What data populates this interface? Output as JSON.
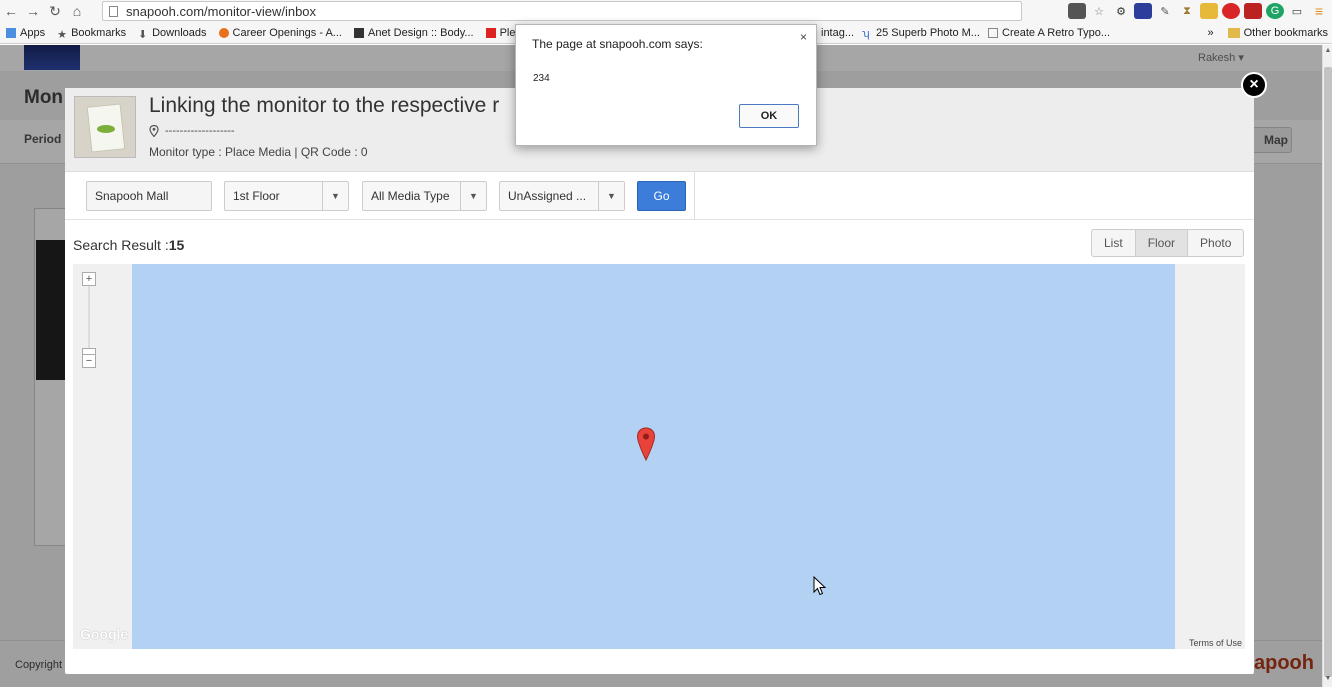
{
  "browser": {
    "url": "snapooh.com/monitor-view/inbox",
    "bookmarks": [
      {
        "label": "Apps",
        "icon": "apps-grid-icon"
      },
      {
        "label": "Bookmarks",
        "icon": "star-icon"
      },
      {
        "label": "Downloads",
        "icon": "download-icon"
      },
      {
        "label": "Career Openings - A...",
        "icon": "career-icon"
      },
      {
        "label": "Anet Design :: Body...",
        "icon": "anet-icon"
      },
      {
        "label": "Plexus Fi",
        "icon": "youtube-icon"
      },
      {
        "label": "intag...",
        "icon": "page-icon"
      },
      {
        "label": "25 Superb Photo M...",
        "icon": "site-icon"
      },
      {
        "label": "Create A Retro Typo...",
        "icon": "page-icon"
      }
    ],
    "more_label": "»",
    "other_bookmarks": "Other bookmarks"
  },
  "background_page": {
    "title": "Mon",
    "period_label": "Period",
    "user_name": "Rakesh",
    "map_button": "Map",
    "copyright": "Copyright",
    "brand": "apooh"
  },
  "modal": {
    "title": "Linking the monitor to the respective r",
    "location": "-------------------",
    "meta": "Monitor type : Place Media | QR Code : 0",
    "filters": {
      "mall": "Snapooh Mall",
      "floor": "1st Floor",
      "media_type": "All Media Type",
      "assignment": "UnAssigned ...",
      "go_label": "Go"
    },
    "search_result_label": "Search Result :",
    "search_result_count": "15",
    "views": [
      "List",
      "Floor",
      "Photo"
    ],
    "active_view": "Floor",
    "map": {
      "google_label": "Google",
      "terms_label": "Terms of Use",
      "zoom_in": "+",
      "zoom_out": "−"
    },
    "close_label": "×"
  },
  "alert": {
    "title": "The page at snapooh.com says:",
    "message": "234",
    "ok_label": "OK",
    "close_label": "×"
  },
  "colors": {
    "map_water": "#b3d1f2",
    "go_button": "#3b7dd8",
    "marker": "#e8423a"
  }
}
